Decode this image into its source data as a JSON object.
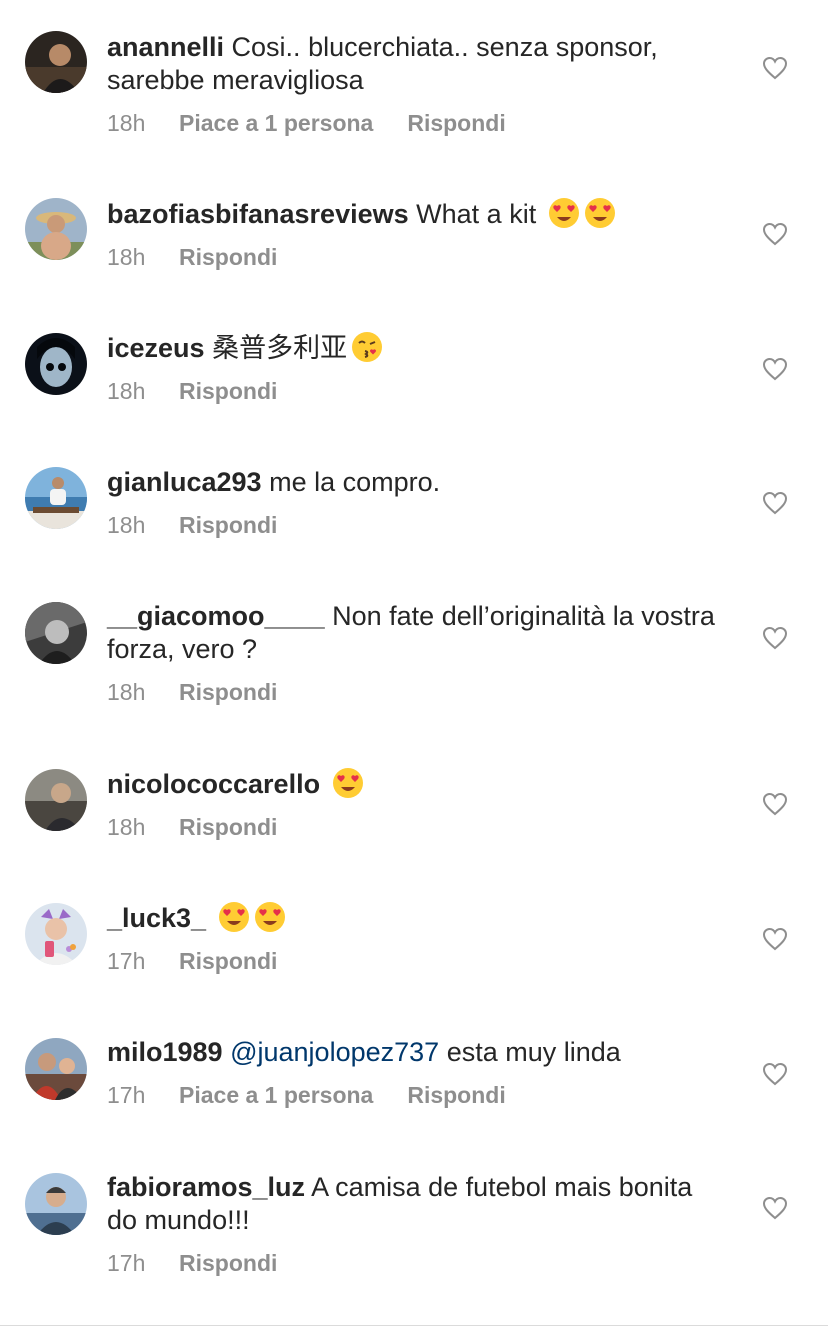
{
  "comments": [
    {
      "username": "anannelli",
      "text": "Cosi.. blucerchiata.. senza sponsor, sarebbe meravigliosa",
      "time": "18h",
      "likes": "Piace a 1 persona",
      "reply": "Rispondi",
      "avatar_color": "#3a3028"
    },
    {
      "username": "bazofiasbifanasreviews",
      "text": "What a kit",
      "emoji": "😍😍",
      "time": "18h",
      "reply": "Rispondi",
      "avatar_color": "#8aa0b8"
    },
    {
      "username": "icezeus",
      "text": "桑普多利亚",
      "emoji": "😘",
      "time": "18h",
      "reply": "Rispondi",
      "avatar_color": "#101820"
    },
    {
      "username": "gianluca293",
      "text": "me la compro.",
      "time": "18h",
      "reply": "Rispondi",
      "avatar_color": "#5f93c0"
    },
    {
      "username": "__giacomoo____",
      "text": "Non fate dell’originalità la vostra forza, vero ?",
      "time": "18h",
      "reply": "Rispondi",
      "avatar_color": "#555555"
    },
    {
      "username": "nicolococcarello",
      "emoji": "😍",
      "time": "18h",
      "reply": "Rispondi",
      "avatar_color": "#5d5a52"
    },
    {
      "username": "_luck3_",
      "emoji": "😍😍",
      "time": "17h",
      "reply": "Rispondi",
      "avatar_color": "#c9d6e6"
    },
    {
      "username": "milo1989",
      "mention": "@juanjolopez737",
      "text": "esta muy linda",
      "time": "17h",
      "likes": "Piace a 1 persona",
      "reply": "Rispondi",
      "avatar_color": "#8b5a48"
    },
    {
      "username": "fabioramos_luz",
      "text": "A camisa de futebol mais bonita do mundo!!!",
      "time": "17h",
      "reply": "Rispondi",
      "avatar_color": "#6f8fb3"
    }
  ],
  "icons": {
    "like": "heart-outline-icon",
    "emoji_heart_eyes": "heart-eyes-emoji",
    "emoji_kiss": "kissing-face-emoji"
  },
  "colors": {
    "text": "#262626",
    "secondary": "#8e8e8e",
    "mention": "#00376b",
    "emoji_face": "#ffcc33",
    "emoji_heart": "#e5304a"
  }
}
